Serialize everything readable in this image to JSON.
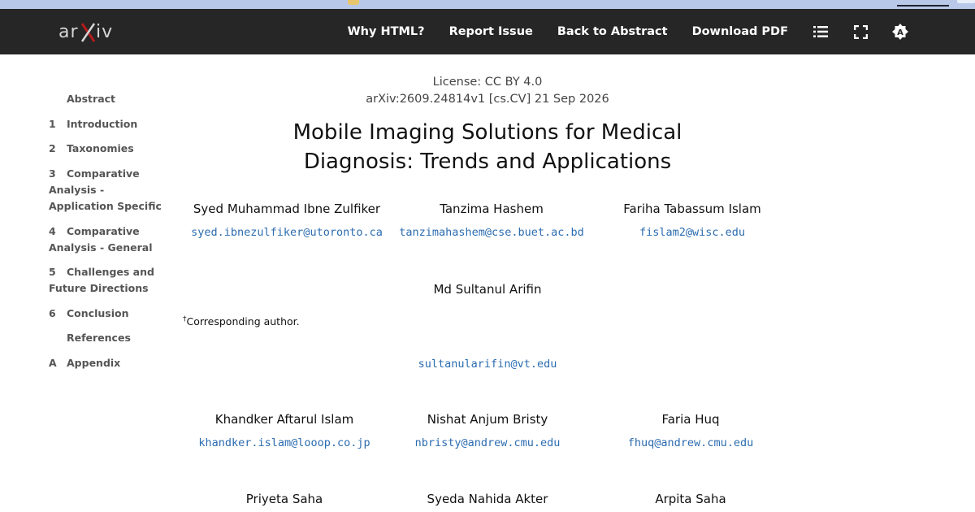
{
  "topbar": {
    "logo": "arXiv",
    "nav": [
      "Why HTML?",
      "Report Issue",
      "Back to Abstract",
      "Download PDF"
    ],
    "icons": [
      "list-icon",
      "fullscreen-icon",
      "theme-icon"
    ]
  },
  "toc": {
    "items": [
      {
        "num": "",
        "label": "Abstract"
      },
      {
        "num": "1",
        "label": "Introduction"
      },
      {
        "num": "2",
        "label": "Taxonomies"
      },
      {
        "num": "3",
        "label": "Comparative Analysis - Application Specific"
      },
      {
        "num": "4",
        "label": "Comparative Analysis - General"
      },
      {
        "num": "5",
        "label": "Challenges and Future Directions"
      },
      {
        "num": "6",
        "label": "Conclusion"
      },
      {
        "num": "",
        "label": "References"
      },
      {
        "num": "A",
        "label": "Appendix"
      }
    ]
  },
  "paper": {
    "license": "License: CC BY 4.0",
    "arxiv_id": "arXiv:2609.24814v1 [cs.CV] 21 Sep 2026",
    "title_line1": "Mobile Imaging Solutions for Medical",
    "title_line2": "Diagnosis: Trends and Applications",
    "authors": [
      {
        "name": "Syed Muhammad Ibne Zulfiker",
        "email": "syed.ibnezulfiker@utoronto.ca"
      },
      {
        "name": "Tanzima Hashem",
        "email": "tanzimahashem@cse.buet.ac.bd"
      },
      {
        "name": "Fariha Tabassum Islam",
        "email": "fislam2@wisc.edu"
      },
      {
        "name": "Md Sultanul Arifin",
        "email": "sultanularifin@vt.edu"
      },
      {
        "name": "Khandker Aftarul Islam",
        "email": "khandker.islam@looop.co.jp"
      },
      {
        "name": "Nishat Anjum Bristy",
        "email": "nbristy@andrew.cmu.edu"
      },
      {
        "name": "Faria Huq",
        "email": "fhuq@andrew.cmu.edu"
      },
      {
        "name": "Priyeta Saha",
        "email": ""
      },
      {
        "name": "Syeda Nahida Akter",
        "email": ""
      },
      {
        "name": "Arpita Saha",
        "email": ""
      }
    ],
    "footnote_mark": "†",
    "footnote": "Corresponding author."
  }
}
